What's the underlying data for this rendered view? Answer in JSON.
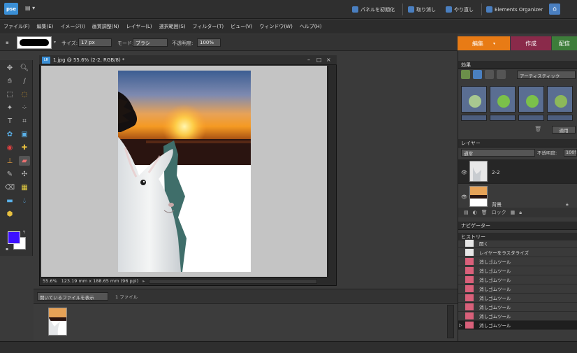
{
  "app": {
    "logo": "pse",
    "title_buttons": {
      "panel_reset": "パネルを初期化",
      "undo": "取り消し",
      "redo": "やり直し",
      "organizer": "Elements Organizer"
    }
  },
  "menu": [
    "ファイル(F)",
    "編集(E)",
    "イメージ(I)",
    "画質調整(N)",
    "レイヤー(L)",
    "選択範囲(S)",
    "フィルター(T)",
    "ビュー(V)",
    "ウィンドウ(W)",
    "ヘルプ(H)"
  ],
  "options": {
    "size_label": "サイズ:",
    "size_value": "17 px",
    "mode_label": "モード:",
    "mode_value": "ブラシ",
    "opacity_label": "不透明度:",
    "opacity_value": "100%"
  },
  "mode_tabs": {
    "edit": "編集",
    "create": "作成",
    "share": "配信"
  },
  "document": {
    "title": "1.jpg @ 55.6% (2-2, RGB/8) *",
    "zoom": "55.6%",
    "dimensions": "123.19 mm x 188.65 mm (96 ppi)"
  },
  "bin": {
    "show_select": "開いているファイルを表示",
    "count": "1 ファイル"
  },
  "panels": {
    "effects": {
      "title": "効果",
      "filter_select": "アーティスティック",
      "apply": "適用"
    },
    "layers": {
      "title": "レイヤー",
      "blend_mode": "通常",
      "opacity_label": "不透明度:",
      "opacity_value": "100%",
      "items": [
        {
          "name": "2-2"
        },
        {
          "name": "背景"
        }
      ],
      "lock_label": "ロック"
    },
    "navigator": {
      "title": "ナビゲーター"
    },
    "history": {
      "title": "ヒストリー",
      "items": [
        "開く",
        "レイヤーをラスタライズ",
        "消しゴムツール",
        "消しゴムツール",
        "消しゴムツール",
        "消しゴムツール",
        "消しゴムツール",
        "消しゴムツール",
        "消しゴムツール",
        "消しゴムツール"
      ]
    }
  },
  "colors": {
    "foreground": "#3d10ff",
    "background": "#ffffff",
    "edit_tab": "#e87b15",
    "create_tab": "#8a2a4a",
    "share_tab": "#3d7d3a"
  }
}
